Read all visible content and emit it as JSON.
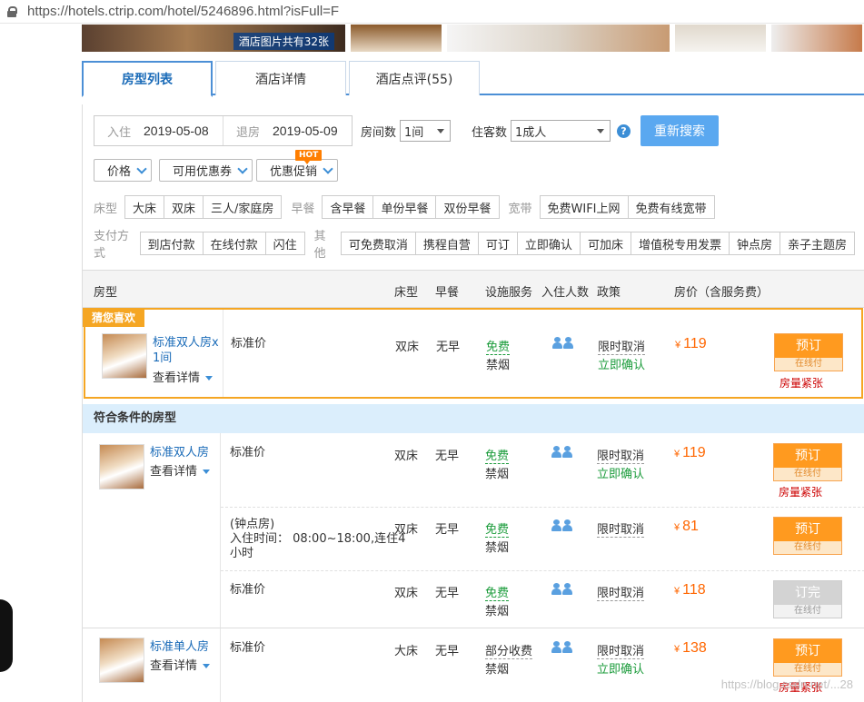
{
  "browser": {
    "url": "https://hotels.ctrip.com/hotel/5246896.html?isFull=F"
  },
  "gallery": {
    "caption": "酒店图片共有32张"
  },
  "tabs": [
    {
      "label": "房型列表"
    },
    {
      "label": "酒店详情"
    },
    {
      "label": "酒店点评(55)"
    }
  ],
  "search": {
    "checkin_label": "入住",
    "checkin": "2019-05-08",
    "checkout_label": "退房",
    "checkout": "2019-05-09",
    "rooms_label": "房间数",
    "rooms": "1间",
    "guests_label": "住客数",
    "guests": "1成人",
    "help": "?",
    "research_button": "重新搜索"
  },
  "dropdowns": {
    "price": "价格",
    "coupon": "可用优惠券",
    "promo": "优惠促销",
    "hot_badge": "HOT"
  },
  "filters": {
    "bed_label": "床型",
    "bed": [
      "大床",
      "双床",
      "三人/家庭房"
    ],
    "breakfast_label": "早餐",
    "breakfast": [
      "含早餐",
      "单份早餐",
      "双份早餐"
    ],
    "broadband_label": "宽带",
    "broadband": [
      "免费WIFI上网",
      "免费有线宽带"
    ],
    "payment_label": "支付方式",
    "payment": [
      "到店付款",
      "在线付款",
      "闪住"
    ],
    "other_label": "其他",
    "other": [
      "可免费取消",
      "携程自营",
      "可订",
      "立即确认",
      "可加床",
      "增值税专用发票",
      "钟点房",
      "亲子主题房"
    ]
  },
  "table_header": {
    "room": "房型",
    "bed": "床型",
    "breakfast": "早餐",
    "facilities": "设施服务",
    "guests": "入住人数",
    "policy": "政策",
    "price": "房价（含服务费）"
  },
  "favorite": {
    "tag": "猜您喜欢",
    "name": "标准双人房x 1间",
    "details": "查看详情",
    "plan": "标准价",
    "bed": "双床",
    "breakfast": "无早",
    "wifi": "免费",
    "smoking": "禁烟",
    "cancel": "限时取消",
    "confirm": "立即确认",
    "currency": "¥",
    "price": "119",
    "book": "预订",
    "pay": "在线付",
    "status": "房量紧张"
  },
  "section_title": "符合条件的房型",
  "rooms": [
    {
      "name": "标准双人房",
      "details": "查看详情",
      "rates": [
        {
          "plan": "标准价",
          "bed": "双床",
          "breakfast": "无早",
          "wifi": "免费",
          "smoking": "禁烟",
          "cancel": "限时取消",
          "confirm": "立即确认",
          "currency": "¥",
          "price": "119",
          "book": "预订",
          "pay": "在线付",
          "status": "房量紧张"
        },
        {
          "plan_line1": "(钟点房)",
          "plan_line2": "入住时间： 08:00~18:00,连住4",
          "plan_line3": "小时",
          "bed": "双床",
          "breakfast": "无早",
          "wifi": "免费",
          "smoking": "禁烟",
          "cancel": "限时取消",
          "currency": "¥",
          "price": "81",
          "book": "预订",
          "pay": "在线付"
        },
        {
          "plan": "标准价",
          "bed": "双床",
          "breakfast": "无早",
          "wifi": "免费",
          "smoking": "禁烟",
          "cancel": "限时取消",
          "currency": "¥",
          "price": "118",
          "book": "订完",
          "pay": "在线付"
        }
      ]
    },
    {
      "name": "标准单人房",
      "details": "查看详情",
      "rates": [
        {
          "plan": "标准价",
          "bed": "大床",
          "breakfast": "无早",
          "wifi": "部分收费",
          "smoking": "禁烟",
          "cancel": "限时取消",
          "confirm": "立即确认",
          "currency": "¥",
          "price": "138",
          "book": "预订",
          "pay": "在线付",
          "status": "房量紧张"
        }
      ]
    }
  ],
  "watermark": "https://blog.csdn.net/...28"
}
